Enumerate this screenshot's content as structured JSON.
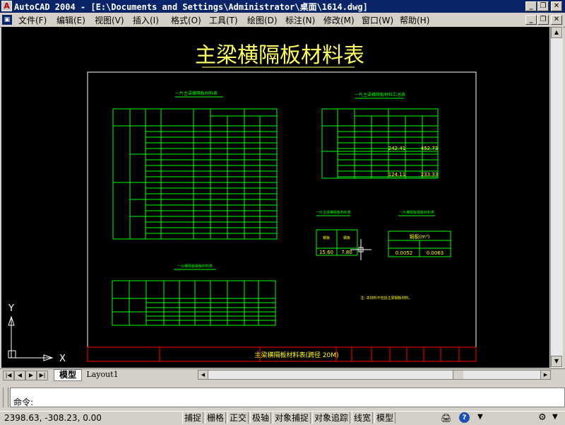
{
  "window": {
    "title": "AutoCAD 2004 - [E:\\Documents and Settings\\Administrator\\桌面\\1614.dwg]"
  },
  "menu": [
    "文件(F)",
    "编辑(E)",
    "视图(V)",
    "插入(I)",
    "格式(O)",
    "工具(T)",
    "绘图(D)",
    "标注(N)",
    "修改(M)",
    "窗口(W)",
    "帮助(H)"
  ],
  "drawing": {
    "main_title": "主梁横隔板材料表",
    "table1_title": "一片主梁横隔板材料表",
    "table2_title": "一片主梁横隔板材料汇总表",
    "table3_title": "一片主梁横隔板材料表",
    "table4_title": "一片横隔板钢板材料表",
    "table5_title": "一片横隔板钢板材料表",
    "note": "注: 本材料不包括主梁钢板材料。",
    "t3_row": [
      "15.60",
      "7.80"
    ],
    "t4_header": "钢板(m³)",
    "t4_row": [
      "0.0052",
      "0.0063"
    ],
    "t2_total1": "242.41",
    "t2_total1b": "452.73",
    "t2_total2": "124.11",
    "t2_total2b": "233.33",
    "titleblock_center": "主梁横隔板材料表(跨径 20M)",
    "ucs_y": "Y",
    "ucs_x": "X"
  },
  "tabs": {
    "model": "模型",
    "layout": "Layout1"
  },
  "command": {
    "prompt": "命令:"
  },
  "status": {
    "coords": "2398.63, -308.23, 0.00",
    "toggles": [
      "捕捉",
      "栅格",
      "正交",
      "极轴",
      "对象捕捉",
      "对象追踪",
      "线宽",
      "模型"
    ]
  },
  "colors": {
    "background": "#000000",
    "table_lines": "#00ff00",
    "text_yellow": "#ffff00",
    "title_yellow": "#ffff66",
    "border_white": "#ffffff",
    "titleblock_red": "#ff0000"
  }
}
